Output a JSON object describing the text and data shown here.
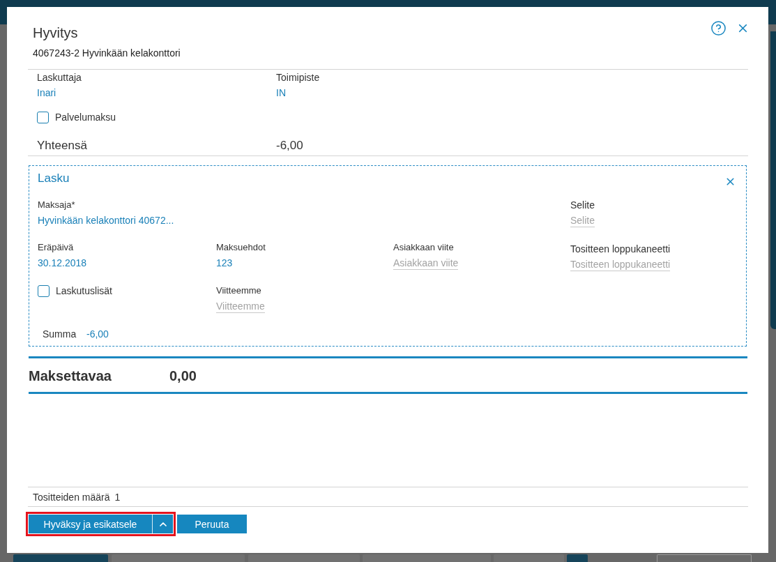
{
  "dialog": {
    "title": "Hyvitys",
    "subtitle": "4067243-2 Hyvinkään kelakonttori"
  },
  "details": {
    "biller": {
      "label": "Laskuttaja",
      "value": "Inari"
    },
    "office": {
      "label": "Toimipiste",
      "value": "IN"
    },
    "service_fee": {
      "label": "Palvelumaksu",
      "checked": false
    },
    "total": {
      "label": "Yhteensä",
      "value": "-6,00"
    }
  },
  "invoice": {
    "title": "Lasku",
    "payer": {
      "label": "Maksaja*",
      "value": "Hyvinkään kelakonttori 40672..."
    },
    "description": {
      "label": "Selite",
      "placeholder": "Selite"
    },
    "due_date": {
      "label": "Eräpäivä",
      "value": "30.12.2018"
    },
    "payment_terms": {
      "label": "Maksuehdot",
      "value": "123"
    },
    "customer_reference": {
      "label": "Asiakkaan viite",
      "placeholder": "Asiakkaan viite"
    },
    "closing_note": {
      "label": "Tositteen loppukaneetti",
      "placeholder": "Tositteen loppukaneetti"
    },
    "billing_extras": {
      "label": "Laskutuslisät",
      "checked": false
    },
    "our_reference": {
      "label": "Viitteemme",
      "placeholder": "Viitteemme"
    },
    "sum": {
      "label": "Summa",
      "value": "-6,00"
    }
  },
  "payable": {
    "label": "Maksettavaa",
    "value": "0,00"
  },
  "footer": {
    "voucher_count": {
      "label": "Tositteiden määrä",
      "value": "1"
    }
  },
  "buttons": {
    "approve": {
      "label": "Hyväksy ja esikatsele",
      "highlighted": true
    },
    "cancel": {
      "label": "Peruuta"
    }
  },
  "background": {
    "bottom_buttons": [
      {
        "kind": "primary"
      },
      {
        "kind": "secondary"
      },
      {
        "kind": "secondary"
      },
      {
        "kind": "secondary"
      },
      {
        "kind": "secondary"
      },
      {
        "kind": "primary"
      },
      {
        "kind": "outline"
      }
    ]
  }
}
